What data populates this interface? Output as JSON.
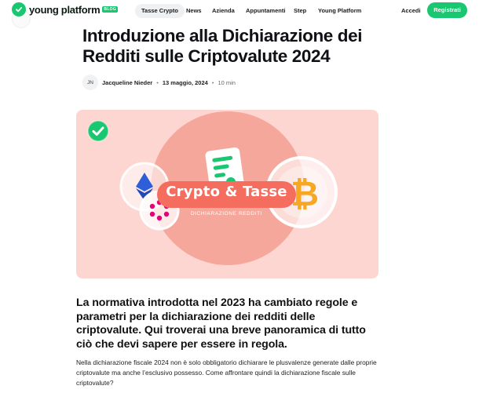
{
  "nav": {
    "logo_text": "young platform",
    "logo_badge": "BLOG",
    "items": [
      "Tasse Crypto",
      "News",
      "Azienda",
      "Appuntamenti",
      "Step",
      "Young Platform"
    ],
    "login_label": "Accedi",
    "cta_label": "Registrati"
  },
  "article": {
    "title": "Introduzione alla Dichiarazione dei Redditi sulle Criptovalute 2024",
    "author_initials": "JN",
    "author": "Jacqueline Nieder",
    "date": "13 maggio, 2024",
    "read_time": "10 min",
    "hero": {
      "headline": "Crypto & Tasse",
      "subheadline": "DICHIARAZIONE REDDITI"
    },
    "lead": "La normativa introdotta nel 2023 ha cambiato regole e parametri per la dichiarazione dei redditi delle criptovalute. Qui troverai una breve panoramica di tutto ciò che devi sapere per essere in regola.",
    "body": "Nella dichiarazione fiscale 2024 non è solo obbligatorio dichiarare le plusvalenze generate dalle proprie criptovalute ma anche l’esclusivo possesso. Come affrontare quindi la dichiarazione fiscale sulle criptovalute?"
  },
  "colors": {
    "brand": "#18c76f",
    "hero_bg": "#fdd5d1",
    "hero_circle": "#f6a79b",
    "pill": "#f46d5f"
  }
}
